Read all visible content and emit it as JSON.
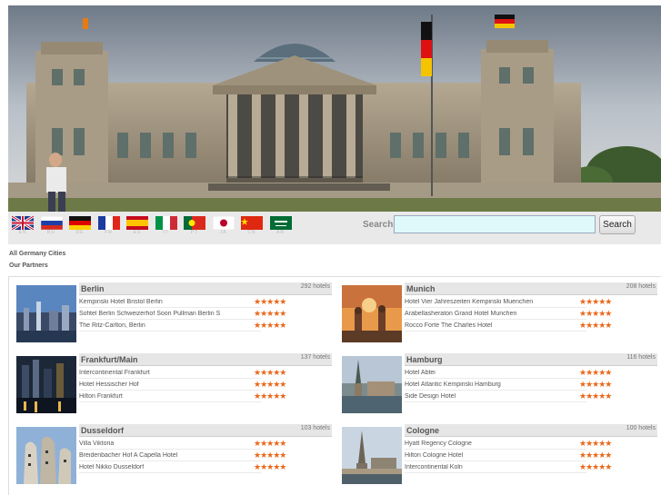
{
  "flags": [
    {
      "name": "uk-flag-icon",
      "code": "EN"
    },
    {
      "name": "russia-flag-icon",
      "code": "RU"
    },
    {
      "name": "germany-flag-icon",
      "code": "DE"
    },
    {
      "name": "france-flag-icon",
      "code": "FR"
    },
    {
      "name": "spain-flag-icon",
      "code": "ES"
    },
    {
      "name": "italy-flag-icon",
      "code": "IT"
    },
    {
      "name": "portugal-flag-icon",
      "code": "PT"
    },
    {
      "name": "japan-flag-icon",
      "code": "JA"
    },
    {
      "name": "china-flag-icon",
      "code": "CN"
    },
    {
      "name": "saudi-flag-icon",
      "code": "AR"
    }
  ],
  "search": {
    "label": "Search",
    "value": "",
    "placeholder": "",
    "button": "Search"
  },
  "links": {
    "all_cities": "All Germany Cities",
    "partners": "Our Partners"
  },
  "stars": "★★★★★",
  "cities": [
    {
      "name": "Berlin",
      "count": "292 hotels",
      "hotels": [
        "Kempinski Hotel Bristol Berlin",
        "Sofitel Berlin Schweizerhof Soon Pullman Berlin S",
        "The Ritz-Carlton, Berlin"
      ]
    },
    {
      "name": "Munich",
      "count": "208 hotels",
      "hotels": [
        "Hotel Vier Jahreszeiten Kempinski Muenchen",
        "Arabellasheraton Grand Hotel Munchen",
        "Rocco Forte The Charles Hotel"
      ]
    },
    {
      "name": "Frankfurt/Main",
      "count": "137 hotels",
      "hotels": [
        "Intercontinental Frankfurt",
        "Hotel Hessischer Hof",
        "Hilton Frankfurt"
      ]
    },
    {
      "name": "Hamburg",
      "count": "116 hotels",
      "hotels": [
        "Hotel Abtei",
        "Hotel Atlantic Kempinski Hamburg",
        "Side Design Hotel"
      ]
    },
    {
      "name": "Dusseldorf",
      "count": "103 hotels",
      "hotels": [
        "Villa Viktoria",
        "Breidenbacher Hof A Capella Hotel",
        "Hotel Nikko Dusseldorf"
      ]
    },
    {
      "name": "Cologne",
      "count": "100 hotels",
      "hotels": [
        "Hyatt Regency Cologne",
        "Hilton Cologne Hotel",
        "Intercontinental Koln"
      ]
    }
  ],
  "colors": {
    "stars": "#e8681a",
    "search_bg": "#dff9fb",
    "bar_bg": "#e9e9e9"
  }
}
